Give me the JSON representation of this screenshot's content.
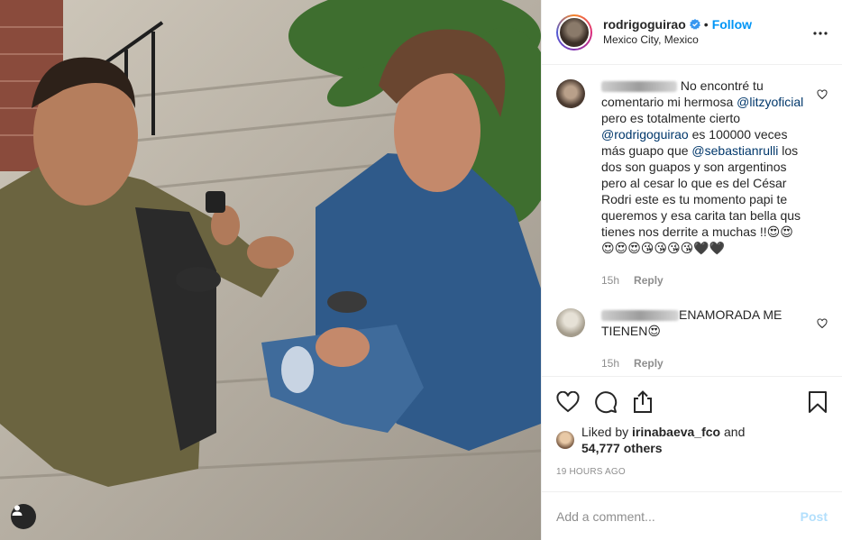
{
  "post": {
    "username": "rodrigoguirao",
    "follow_label": "Follow",
    "separator": "•",
    "location": "Mexico City, Mexico"
  },
  "comments": [
    {
      "text_parts": [
        " No encontré tu comentario mi hermosa ",
        "@litzyoficial",
        " pero es totalmente cierto ",
        "@rodrigoguirao",
        " es 100000 veces más guapo que ",
        "@sebastianrulli",
        " los dos son guapos y son argentinos pero al cesar lo que es del César Rodri este es tu momento papi te queremos y esa carita tan bella qus tienes nos derrite a muchas !!😍😍😍😍😍😘😘😘😘🖤🖤"
      ],
      "time": "15h",
      "reply_label": "Reply"
    },
    {
      "author_blur": "nay_vendr4ll",
      "text": "ENAMORADA ME TIENEN😍",
      "time": "15h",
      "reply_label": "Reply"
    }
  ],
  "likes": {
    "prefix": "Liked by ",
    "user": "irinabaeva_fco",
    "and": " and",
    "count": "54,777 others"
  },
  "timestamp": "19 HOURS AGO",
  "add_comment": {
    "placeholder": "Add a comment...",
    "post_label": "Post"
  },
  "colors": {
    "accent": "#0095f6",
    "mention": "#00376b",
    "muted": "#8e8e8e",
    "post_disabled": "#b2dffc"
  },
  "icons": [
    "user-tag-icon",
    "verified-badge-icon",
    "more-options-icon",
    "heart-icon",
    "comment-icon",
    "share-icon",
    "bookmark-icon"
  ]
}
